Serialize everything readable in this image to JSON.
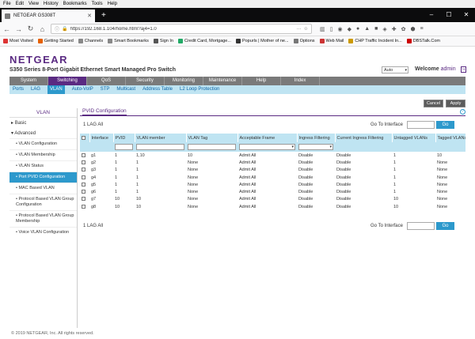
{
  "browser": {
    "menu": [
      "File",
      "Edit",
      "View",
      "History",
      "Bookmarks",
      "Tools",
      "Help"
    ],
    "tab_title": "NETGEAR GS308T",
    "url": "https://192.168.1.104/home.html?aj4=1.0",
    "bookmarks": [
      {
        "label": "Most Visited",
        "color": "#d33"
      },
      {
        "label": "Getting Started",
        "color": "#e66000"
      },
      {
        "label": "Channels",
        "color": "#888"
      },
      {
        "label": "Smart Bookmarks",
        "color": "#888"
      },
      {
        "label": "Sign In",
        "color": "#555"
      },
      {
        "label": "Credit Card, Mortgage...",
        "color": "#2a6"
      },
      {
        "label": "Popurls | Mother of ne...",
        "color": "#333"
      },
      {
        "label": "Options",
        "color": "#777"
      },
      {
        "label": "Web Mail",
        "color": "#c33"
      },
      {
        "label": "CHP Traffic Incident In...",
        "color": "#c90"
      },
      {
        "label": "DBSTalk.Com",
        "color": "#c00"
      }
    ]
  },
  "header": {
    "logo": "NETGEAR",
    "product": "S350 Series 8-Port Gigabit Ethernet Smart Managed Pro Switch",
    "mode": "Auto",
    "welcome": "Welcome",
    "user": "admin"
  },
  "mainnav": [
    "System",
    "Switching",
    "QoS",
    "Security",
    "Monitoring",
    "Maintenance",
    "Help",
    "Index"
  ],
  "mainnav_active": "Switching",
  "subnav": [
    "Ports",
    "LAG",
    "VLAN",
    "Auto-VoIP",
    "STP",
    "Multicast",
    "Address Table",
    "L2 Loop Protection"
  ],
  "subnav_active": "VLAN",
  "actions": {
    "cancel": "Cancel",
    "apply": "Apply"
  },
  "sidebar": {
    "header": "VLAN",
    "basic": "Basic",
    "advanced": "Advanced",
    "items": [
      "VLAN Configuration",
      "VLAN Membership",
      "VLAN Status",
      "Port PVID Configuration",
      "MAC Based VLAN",
      "Protocol Based VLAN Group Configuration",
      "Protocol Based VLAN Group Membership",
      "Voice VLAN Configuration"
    ],
    "active_index": 3
  },
  "content": {
    "tab": "PVID Configuration",
    "lag_toggle": "1 LAG All",
    "goto_label": "Go To Interface",
    "go_button": "Go",
    "columns": [
      "Interface",
      "PVID",
      "VLAN member",
      "VLAN Tag",
      "Acceptable Frame",
      "Ingress Filtering",
      "Current Ingress Filtering",
      "Untagged VLANs",
      "Tagged VLANs"
    ],
    "rows": [
      [
        "g1",
        "1",
        "1,10",
        "10",
        "Admit All",
        "Disable",
        "Disable",
        "1",
        "10"
      ],
      [
        "g2",
        "1",
        "1",
        "None",
        "Admit All",
        "Disable",
        "Disable",
        "1",
        "None"
      ],
      [
        "g3",
        "1",
        "1",
        "None",
        "Admit All",
        "Disable",
        "Disable",
        "1",
        "None"
      ],
      [
        "g4",
        "1",
        "1",
        "None",
        "Admit All",
        "Disable",
        "Disable",
        "1",
        "None"
      ],
      [
        "g5",
        "1",
        "1",
        "None",
        "Admit All",
        "Disable",
        "Disable",
        "1",
        "None"
      ],
      [
        "g6",
        "1",
        "1",
        "None",
        "Admit All",
        "Disable",
        "Disable",
        "1",
        "None"
      ],
      [
        "g7",
        "10",
        "10",
        "None",
        "Admit All",
        "Disable",
        "Disable",
        "10",
        "None"
      ],
      [
        "g8",
        "10",
        "10",
        "None",
        "Admit All",
        "Disable",
        "Disable",
        "10",
        "None"
      ]
    ]
  },
  "footer": "© 2019 NETGEAR, Inc. All rights reserved.",
  "colors": {
    "brand": "#5a2a82",
    "accent": "#2d99cc",
    "header_bg": "#bfe4f2"
  }
}
